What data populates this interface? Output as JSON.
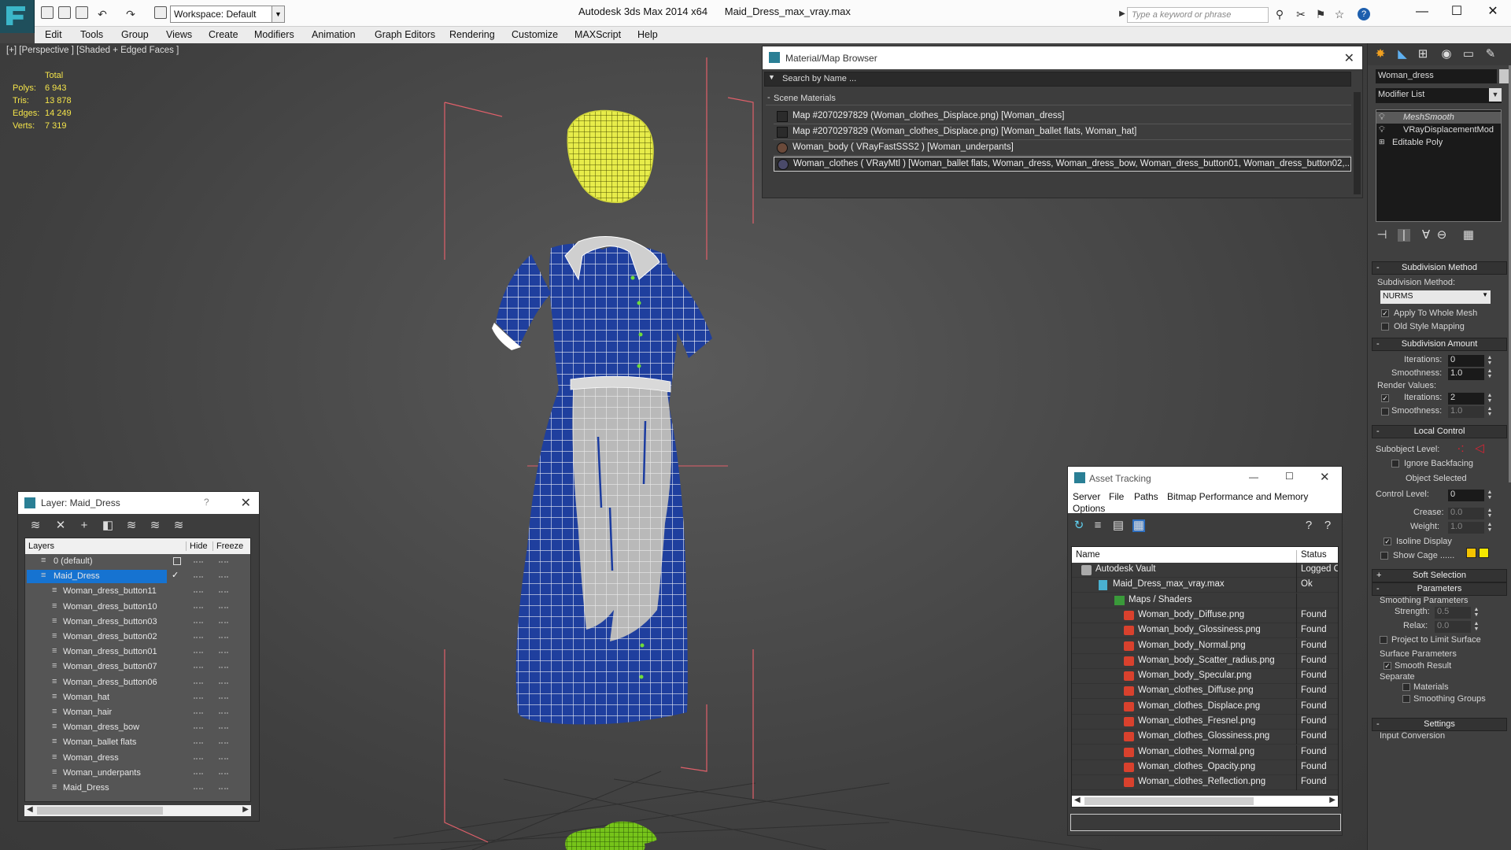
{
  "titlebar": {
    "workspace": "Workspace: Default",
    "app_name": "Autodesk 3ds Max  2014 x64",
    "file_name": "Maid_Dress_max_vray.max",
    "search_placeholder": "Type a keyword or phrase"
  },
  "menu": [
    "Edit",
    "Tools",
    "Group",
    "Views",
    "Create",
    "Modifiers",
    "Animation",
    "Graph Editors",
    "Rendering",
    "Customize",
    "MAXScript",
    "Help"
  ],
  "viewport": {
    "label": "[+] [Perspective ] [Shaded + Edged Faces ]",
    "stats": {
      "header": "Total",
      "rows": [
        {
          "label": "Polys:",
          "value": "6 943"
        },
        {
          "label": "Tris:",
          "value": "13 878"
        },
        {
          "label": "Edges:",
          "value": "14 249"
        },
        {
          "label": "Verts:",
          "value": "7 319"
        }
      ]
    }
  },
  "material_browser": {
    "title": "Material/Map Browser",
    "search": "Search by Name ...",
    "section": "Scene Materials",
    "items": [
      "Map #2070297829 (Woman_clothes_Displace.png) [Woman_dress]",
      "Map #2070297829 (Woman_clothes_Displace.png) [Woman_ballet flats, Woman_hat]",
      "Woman_body  ( VRayFastSSS2 )  [Woman_underpants]",
      "Woman_clothes  ( VRayMtl ) [Woman_ballet flats, Woman_dress, Woman_dress_bow, Woman_dress_button01, Woman_dress_button02,..."
    ]
  },
  "layer_panel": {
    "title": "Layer: Maid_Dress",
    "help": "?",
    "columns": {
      "layers": "Layers",
      "hide": "Hide",
      "freeze": "Freeze"
    },
    "rows": [
      {
        "name": "0 (default)",
        "level": 0
      },
      {
        "name": "Maid_Dress",
        "level": 0,
        "selected": true
      },
      {
        "name": "Woman_dress_button11",
        "level": 1
      },
      {
        "name": "Woman_dress_button10",
        "level": 1
      },
      {
        "name": "Woman_dress_button03",
        "level": 1
      },
      {
        "name": "Woman_dress_button02",
        "level": 1
      },
      {
        "name": "Woman_dress_button01",
        "level": 1
      },
      {
        "name": "Woman_dress_button07",
        "level": 1
      },
      {
        "name": "Woman_dress_button06",
        "level": 1
      },
      {
        "name": "Woman_hat",
        "level": 1
      },
      {
        "name": "Woman_hair",
        "level": 1
      },
      {
        "name": "Woman_dress_bow",
        "level": 1
      },
      {
        "name": "Woman_ballet flats",
        "level": 1
      },
      {
        "name": "Woman_dress",
        "level": 1
      },
      {
        "name": "Woman_underpants",
        "level": 1
      },
      {
        "name": "Maid_Dress",
        "level": 1
      }
    ]
  },
  "asset_tracking": {
    "title": "Asset Tracking",
    "menu": [
      "Server",
      "File",
      "Paths",
      "Bitmap Performance and Memory",
      "Options"
    ],
    "columns": {
      "name": "Name",
      "status": "Status"
    },
    "rows": [
      {
        "name": "Autodesk Vault",
        "status": "Logged O",
        "level": 0,
        "kind": "vault"
      },
      {
        "name": "Maid_Dress_max_vray.max",
        "status": "Ok",
        "level": 1,
        "kind": "file"
      },
      {
        "name": "Maps / Shaders",
        "status": "",
        "level": 2,
        "kind": "folder"
      },
      {
        "name": "Woman_body_Diffuse.png",
        "status": "Found",
        "level": 3,
        "kind": "png"
      },
      {
        "name": "Woman_body_Glossiness.png",
        "status": "Found",
        "level": 3,
        "kind": "png"
      },
      {
        "name": "Woman_body_Normal.png",
        "status": "Found",
        "level": 3,
        "kind": "png"
      },
      {
        "name": "Woman_body_Scatter_radius.png",
        "status": "Found",
        "level": 3,
        "kind": "png"
      },
      {
        "name": "Woman_body_Specular.png",
        "status": "Found",
        "level": 3,
        "kind": "png"
      },
      {
        "name": "Woman_clothes_Diffuse.png",
        "status": "Found",
        "level": 3,
        "kind": "png"
      },
      {
        "name": "Woman_clothes_Displace.png",
        "status": "Found",
        "level": 3,
        "kind": "png"
      },
      {
        "name": "Woman_clothes_Fresnel.png",
        "status": "Found",
        "level": 3,
        "kind": "png"
      },
      {
        "name": "Woman_clothes_Glossiness.png",
        "status": "Found",
        "level": 3,
        "kind": "png"
      },
      {
        "name": "Woman_clothes_Normal.png",
        "status": "Found",
        "level": 3,
        "kind": "png"
      },
      {
        "name": "Woman_clothes_Opacity.png",
        "status": "Found",
        "level": 3,
        "kind": "png"
      },
      {
        "name": "Woman_clothes_Reflection.png",
        "status": "Found",
        "level": 3,
        "kind": "png"
      }
    ]
  },
  "command_panel": {
    "object_name": "Woman_dress",
    "modifier_list": "Modifier List",
    "stack": [
      "MeshSmooth",
      "VRayDisplacementMod",
      "Editable Poly"
    ],
    "subdivision_method": {
      "title": "Subdivision Method",
      "label": "Subdivision Method:",
      "value": "NURMS",
      "apply_whole_mesh": "Apply To Whole Mesh",
      "old_style": "Old Style Mapping"
    },
    "subdivision_amount": {
      "title": "Subdivision Amount",
      "iterations_label": "Iterations:",
      "iterations": "0",
      "smoothness_label": "Smoothness:",
      "smoothness": "1.0",
      "render_values": "Render Values:",
      "render_iterations": "2",
      "render_smoothness": "1.0"
    },
    "local_control": {
      "title": "Local Control",
      "subobject_level": "Subobject Level:",
      "ignore_backfacing": "Ignore Backfacing",
      "object_selected": "Object Selected",
      "control_level_label": "Control Level:",
      "control_level": "0",
      "crease_label": "Crease:",
      "crease": "0.0",
      "weight_label": "Weight:",
      "weight": "1.0",
      "isoline": "Isoline Display",
      "show_cage": "Show Cage ......",
      "cage_colors": [
        "#f5c400",
        "#f5e800"
      ]
    },
    "soft_selection": "Soft Selection",
    "parameters": {
      "title": "Parameters",
      "smoothing": "Smoothing Parameters",
      "strength_label": "Strength:",
      "strength": "0.5",
      "relax_label": "Relax:",
      "relax": "0.0",
      "project": "Project to Limit Surface",
      "surface": "Surface Parameters",
      "smooth_result": "Smooth Result",
      "separate": "Separate",
      "materials": "Materials",
      "smoothing_groups": "Smoothing Groups"
    },
    "settings": "Settings",
    "input_conversion": "Input Conversion"
  },
  "colors": {
    "dress_blue": "#1f3f9e",
    "apron": "#b9b9b9",
    "wire": "#ffffff",
    "hat": "#e7ec4a",
    "shoes": "#76c41a",
    "bbox": "#e0606a",
    "selection": "#1673d1"
  }
}
